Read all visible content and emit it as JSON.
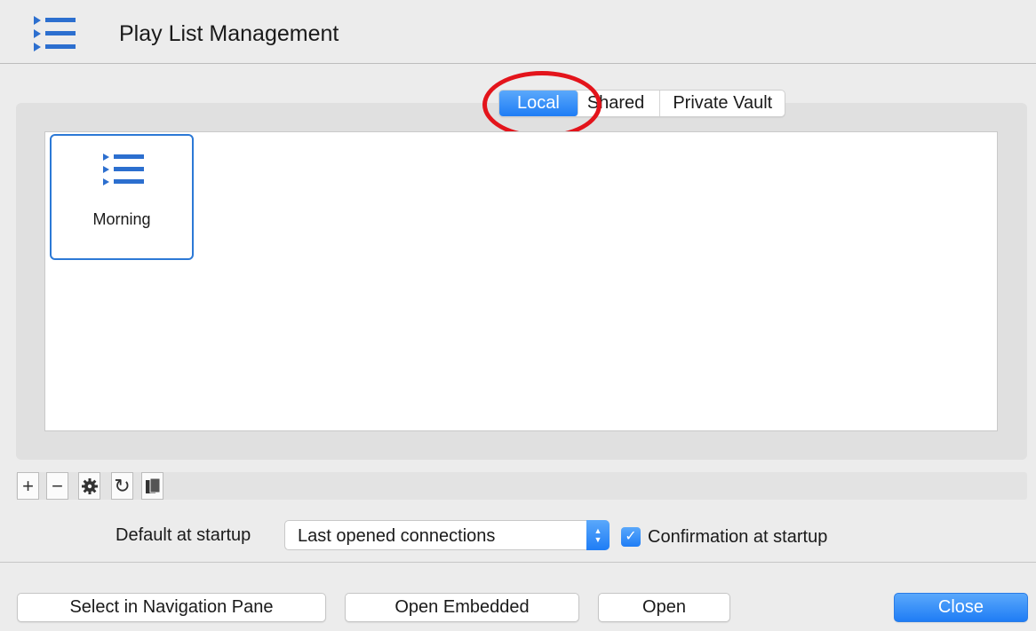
{
  "window": {
    "title": "Play List Management"
  },
  "icons": {
    "header": "playlist-icon",
    "item": "playlist-icon",
    "gear": "gear-icon",
    "refresh": "refresh-icon",
    "copy": "copy-icon"
  },
  "tabs": [
    {
      "label": "Local",
      "active": true
    },
    {
      "label": "Shared",
      "active": false
    },
    {
      "label": "Private Vault",
      "active": false
    }
  ],
  "playlists": [
    {
      "name": "Morning",
      "selected": true
    }
  ],
  "toolbar": {
    "add": "+",
    "remove": "−",
    "refresh": "↻"
  },
  "startup": {
    "label": "Default at startup",
    "value": "Last opened connections",
    "confirm_label": "Confirmation at startup",
    "confirm_checked": true,
    "check_glyph": "✓"
  },
  "buttons": {
    "select_nav": "Select in Navigation Pane",
    "open_embedded": "Open Embedded",
    "open": "Open",
    "close": "Close"
  },
  "colors": {
    "accent": "#1f7df5",
    "annotation": "#e3141b"
  }
}
